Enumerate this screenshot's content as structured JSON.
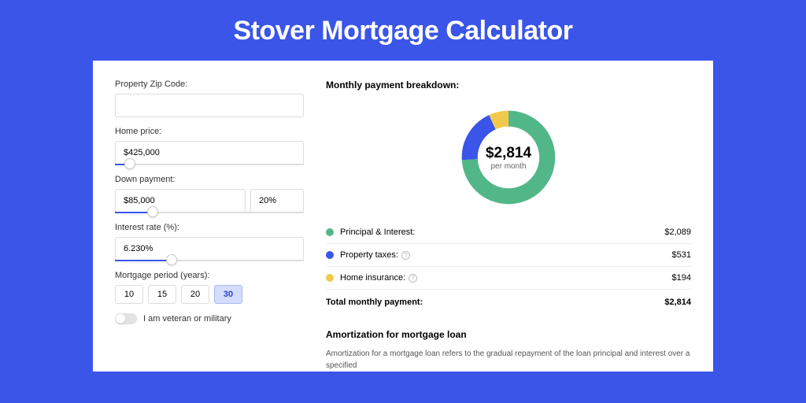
{
  "title": "Stover Mortgage Calculator",
  "form": {
    "zip_label": "Property Zip Code:",
    "zip_value": "",
    "home_label": "Home price:",
    "home_value": "$425,000",
    "home_slider_pct": 8,
    "dp_label": "Down payment:",
    "dp_value": "$85,000",
    "dp_pct": "20%",
    "dp_slider_pct": 20,
    "rate_label": "Interest rate (%):",
    "rate_value": "6.230%",
    "rate_slider_pct": 30,
    "period_label": "Mortgage period (years):",
    "periods": [
      "10",
      "15",
      "20",
      "30"
    ],
    "period_active": "30",
    "veteran_label": "I am veteran or military"
  },
  "breakdown": {
    "heading": "Monthly payment breakdown:",
    "center_value": "$2,814",
    "center_sub": "per month",
    "items": [
      {
        "label": "Principal & Interest:",
        "value": "$2,089",
        "color": "#52b788",
        "pct": 74,
        "info": false
      },
      {
        "label": "Property taxes:",
        "value": "$531",
        "color": "#3a55e8",
        "pct": 19,
        "info": true
      },
      {
        "label": "Home insurance:",
        "value": "$194",
        "color": "#f2c94c",
        "pct": 7,
        "info": true
      }
    ],
    "total_label": "Total monthly payment:",
    "total_value": "$2,814"
  },
  "amort": {
    "heading": "Amortization for mortgage loan",
    "text": "Amortization for a mortgage loan refers to the gradual repayment of the loan principal and interest over a specified"
  },
  "chart_data": {
    "type": "pie",
    "title": "Monthly payment breakdown",
    "categories": [
      "Principal & Interest",
      "Property taxes",
      "Home insurance"
    ],
    "values": [
      2089,
      531,
      194
    ],
    "colors": [
      "#52b788",
      "#3a55e8",
      "#f2c94c"
    ]
  }
}
